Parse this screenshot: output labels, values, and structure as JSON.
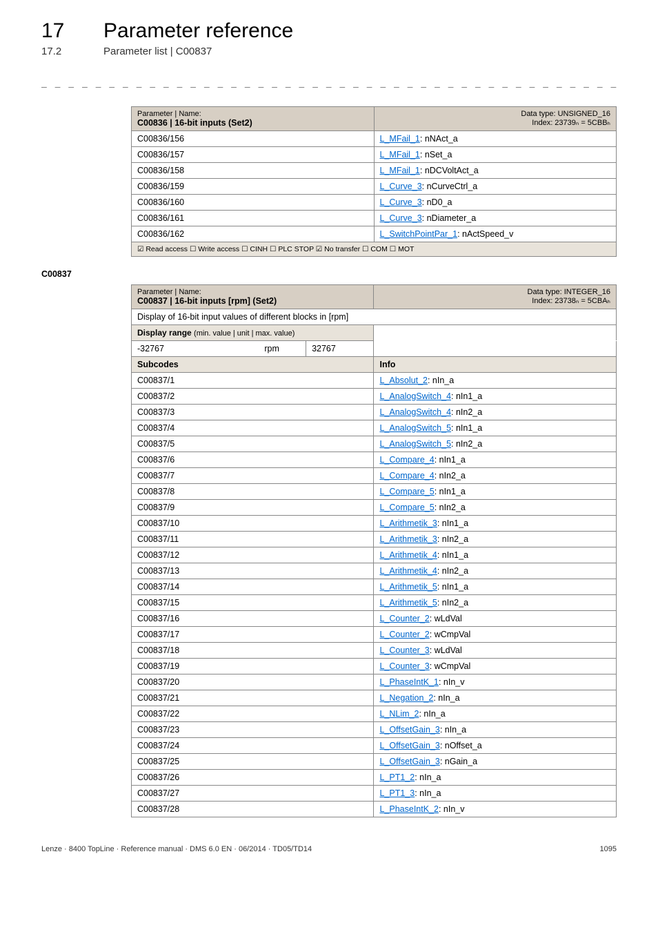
{
  "header": {
    "chapter_number": "17",
    "chapter_title": "Parameter reference",
    "section_number": "17.2",
    "section_title": "Parameter list | C00837"
  },
  "table1": {
    "param_label": "Parameter | Name:",
    "param_code": "C00836 | 16-bit inputs (Set2)",
    "dtype_line": "Data type: UNSIGNED_16",
    "index_line": "Index: 23739ₙ = 5CBBₕ",
    "footer": "☑ Read access  ☐ Write access  ☐ CINH  ☐ PLC STOP  ☑ No transfer  ☐ COM  ☐ MOT",
    "rows": [
      {
        "code": "C00836/156",
        "link": "L_MFail_1",
        "suffix": ": nNAct_a"
      },
      {
        "code": "C00836/157",
        "link": "L_MFail_1",
        "suffix": ": nSet_a"
      },
      {
        "code": "C00836/158",
        "link": "L_MFail_1",
        "suffix": ": nDCVoltAct_a"
      },
      {
        "code": "C00836/159",
        "link": "L_Curve_3",
        "suffix": ": nCurveCtrl_a"
      },
      {
        "code": "C00836/160",
        "link": "L_Curve_3",
        "suffix": ": nD0_a"
      },
      {
        "code": "C00836/161",
        "link": "L_Curve_3",
        "suffix": ": nDiameter_a"
      },
      {
        "code": "C00836/162",
        "link": "L_SwitchPointPar_1",
        "suffix": ": nActSpeed_v"
      }
    ]
  },
  "section_code": "C00837",
  "table2": {
    "param_label": "Parameter | Name:",
    "param_code": "C00837 | 16-bit inputs [rpm] (Set2)",
    "dtype_line": "Data type: INTEGER_16",
    "index_line": "Index: 23738ₙ = 5CBAₕ",
    "desc_row": "Display of 16-bit input values of different blocks in [rpm]",
    "range_label": "Display range (min. value | unit | max. value)",
    "range_min": "-32767",
    "range_unit": "rpm",
    "range_max": "32767",
    "sub_label": "Subcodes",
    "info_label": "Info",
    "rows": [
      {
        "code": "C00837/1",
        "link": "L_Absolut_2",
        "suffix": ": nIn_a"
      },
      {
        "code": "C00837/2",
        "link": "L_AnalogSwitch_4",
        "suffix": ": nIn1_a"
      },
      {
        "code": "C00837/3",
        "link": "L_AnalogSwitch_4",
        "suffix": ": nIn2_a"
      },
      {
        "code": "C00837/4",
        "link": "L_AnalogSwitch_5",
        "suffix": ": nIn1_a"
      },
      {
        "code": "C00837/5",
        "link": "L_AnalogSwitch_5",
        "suffix": ": nIn2_a"
      },
      {
        "code": "C00837/6",
        "link": "L_Compare_4",
        "suffix": ": nIn1_a"
      },
      {
        "code": "C00837/7",
        "link": "L_Compare_4",
        "suffix": ": nIn2_a"
      },
      {
        "code": "C00837/8",
        "link": "L_Compare_5",
        "suffix": ": nIn1_a"
      },
      {
        "code": "C00837/9",
        "link": "L_Compare_5",
        "suffix": ": nIn2_a"
      },
      {
        "code": "C00837/10",
        "link": "L_Arithmetik_3",
        "suffix": ": nIn1_a"
      },
      {
        "code": "C00837/11",
        "link": "L_Arithmetik_3",
        "suffix": ": nIn2_a"
      },
      {
        "code": "C00837/12",
        "link": "L_Arithmetik_4",
        "suffix": ": nIn1_a"
      },
      {
        "code": "C00837/13",
        "link": "L_Arithmetik_4",
        "suffix": ": nIn2_a"
      },
      {
        "code": "C00837/14",
        "link": "L_Arithmetik_5",
        "suffix": ": nIn1_a"
      },
      {
        "code": "C00837/15",
        "link": "L_Arithmetik_5",
        "suffix": ": nIn2_a"
      },
      {
        "code": "C00837/16",
        "link": "L_Counter_2",
        "suffix": ": wLdVal"
      },
      {
        "code": "C00837/17",
        "link": "L_Counter_2",
        "suffix": ": wCmpVal"
      },
      {
        "code": "C00837/18",
        "link": "L_Counter_3",
        "suffix": ": wLdVal"
      },
      {
        "code": "C00837/19",
        "link": "L_Counter_3",
        "suffix": ": wCmpVal"
      },
      {
        "code": "C00837/20",
        "link": "L_PhaseIntK_1",
        "suffix": ": nIn_v"
      },
      {
        "code": "C00837/21",
        "link": "L_Negation_2",
        "suffix": ": nIn_a"
      },
      {
        "code": "C00837/22",
        "link": "L_NLim_2",
        "suffix": ": nIn_a"
      },
      {
        "code": "C00837/23",
        "link": "L_OffsetGain_3",
        "suffix": ": nIn_a"
      },
      {
        "code": "C00837/24",
        "link": "L_OffsetGain_3",
        "suffix": ": nOffset_a"
      },
      {
        "code": "C00837/25",
        "link": "L_OffsetGain_3",
        "suffix": ": nGain_a"
      },
      {
        "code": "C00837/26",
        "link": "L_PT1_2",
        "suffix": ": nIn_a"
      },
      {
        "code": "C00837/27",
        "link": "L_PT1_3",
        "suffix": ": nIn_a"
      },
      {
        "code": "C00837/28",
        "link": "L_PhaseIntK_2",
        "suffix": ": nIn_v"
      }
    ]
  },
  "footer": {
    "left": "Lenze · 8400 TopLine · Reference manual · DMS 6.0 EN · 06/2014 · TD05/TD14",
    "right": "1095"
  }
}
